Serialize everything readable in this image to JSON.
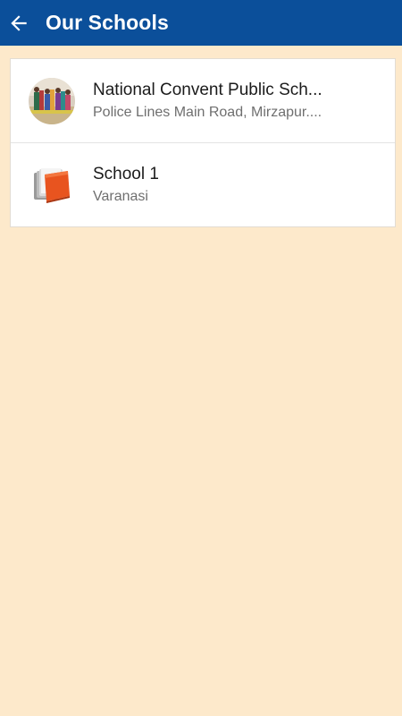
{
  "app_bar": {
    "title": "Our Schools",
    "back_icon": "arrow-left-icon",
    "color": "#0b4f9a"
  },
  "background_color": "#fde9cb",
  "schools": [
    {
      "name": "National Convent Public Sch...",
      "address": "Police Lines Main Road, Mirzapur....",
      "icon": "school-photo-avatar"
    },
    {
      "name": "School 1",
      "address": "Varanasi",
      "icon": "folder-icon"
    }
  ]
}
